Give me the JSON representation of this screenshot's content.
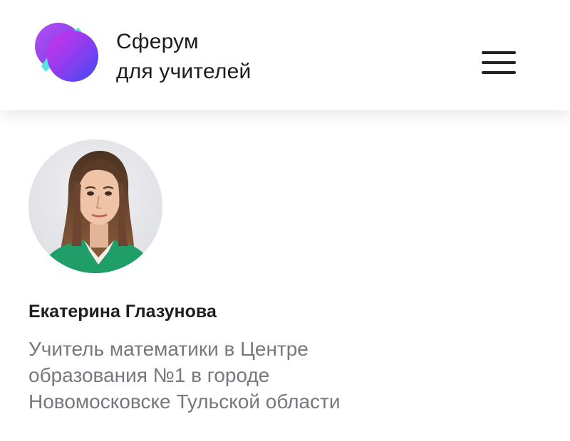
{
  "app": {
    "brand_line1": "Сферум",
    "brand_line2": "для учителей",
    "logo_icon": "sferum-logo-icon",
    "menu_icon": "hamburger-menu-icon"
  },
  "profile": {
    "name": "Екатерина Глазунова",
    "description_lines": [
      "Учитель математики в Центре",
      "образования №1 в городе",
      "Новомосковске Тульской области"
    ]
  },
  "colors": {
    "logo_cyan": "#4fe0e3",
    "logo_purple": "#a52ee6",
    "logo_blue": "#4a4ef0",
    "name_text": "#1e1e22",
    "description_text": "#77777f"
  }
}
